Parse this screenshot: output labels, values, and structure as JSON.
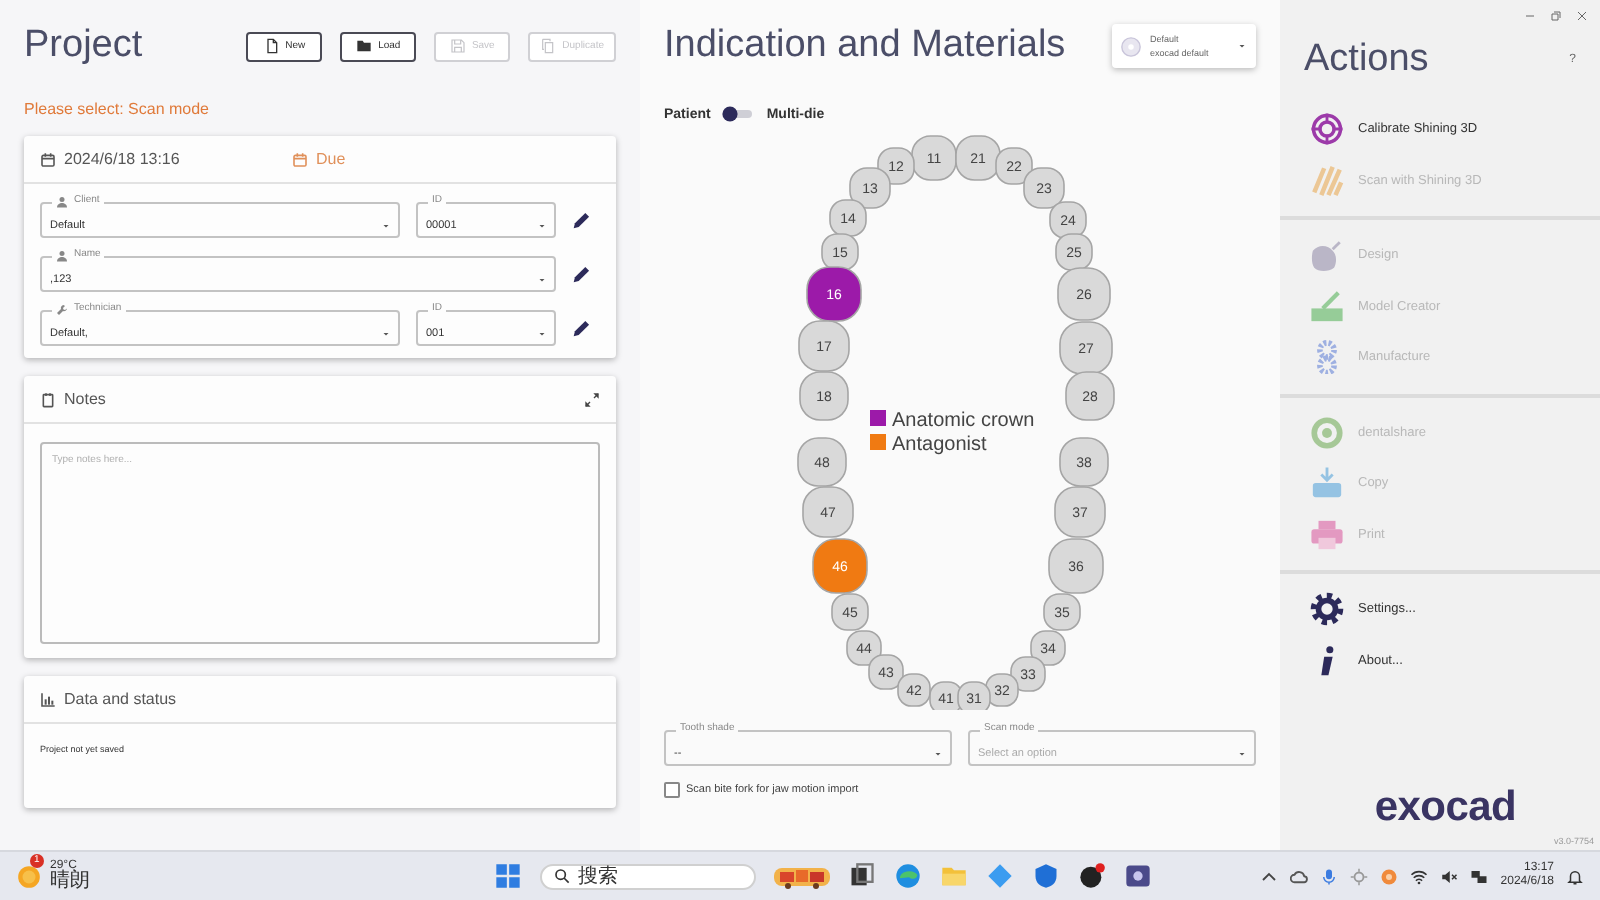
{
  "project": {
    "title": "Project",
    "buttons": [
      {
        "label": "New",
        "disabled": false
      },
      {
        "label": "Load",
        "disabled": false
      },
      {
        "label": "Save",
        "disabled": true
      },
      {
        "label": "Duplicate",
        "disabled": true
      }
    ],
    "warning": "Please select: Scan mode",
    "date": "2024/6/18 13:16",
    "due": "Due",
    "fields": [
      {
        "label": "Client",
        "value": "Default",
        "id_label": "ID",
        "id_value": "00001"
      },
      {
        "label": "Name",
        "value": ",123"
      },
      {
        "label": "Technician",
        "value": "Default,",
        "id_label": "ID",
        "id_value": "001"
      }
    ],
    "notes": {
      "title": "Notes",
      "placeholder": "Type notes here..."
    },
    "status": {
      "title": "Data and status",
      "text": "Project not yet saved"
    }
  },
  "indication": {
    "title": "Indication and Materials",
    "preset": {
      "name": "Default",
      "subtitle": "exocad default"
    },
    "toggle": {
      "left": "Patient",
      "right": "Multi-die",
      "on": false
    },
    "teeth": [
      {
        "number": "11",
        "color": "#d9d9d9"
      },
      {
        "number": "21",
        "color": "#d9d9d9"
      },
      {
        "number": "12",
        "color": "#d9d9d9"
      },
      {
        "number": "22",
        "color": "#d9d9d9"
      },
      {
        "number": "13",
        "color": "#d9d9d9"
      },
      {
        "number": "23",
        "color": "#d9d9d9"
      },
      {
        "number": "14",
        "color": "#d9d9d9"
      },
      {
        "number": "24",
        "color": "#d9d9d9"
      },
      {
        "number": "15",
        "color": "#d9d9d9"
      },
      {
        "number": "25",
        "color": "#d9d9d9"
      },
      {
        "number": "16",
        "color": "#9c1aa9"
      },
      {
        "number": "26",
        "color": "#d9d9d9"
      },
      {
        "number": "17",
        "color": "#d9d9d9"
      },
      {
        "number": "27",
        "color": "#d9d9d9"
      },
      {
        "number": "18",
        "color": "#d9d9d9"
      },
      {
        "number": "28",
        "color": "#d9d9d9"
      },
      {
        "number": "48",
        "color": "#d9d9d9"
      },
      {
        "number": "38",
        "color": "#d9d9d9"
      },
      {
        "number": "47",
        "color": "#d9d9d9"
      },
      {
        "number": "37",
        "color": "#d9d9d9"
      },
      {
        "number": "46",
        "color": "#f07a12"
      },
      {
        "number": "36",
        "color": "#d9d9d9"
      },
      {
        "number": "45",
        "color": "#d9d9d9"
      },
      {
        "number": "35",
        "color": "#d9d9d9"
      },
      {
        "number": "44",
        "color": "#d9d9d9"
      },
      {
        "number": "34",
        "color": "#d9d9d9"
      },
      {
        "number": "43",
        "color": "#d9d9d9"
      },
      {
        "number": "33",
        "color": "#d9d9d9"
      },
      {
        "number": "42",
        "color": "#d9d9d9"
      },
      {
        "number": "32",
        "color": "#d9d9d9"
      },
      {
        "number": "41",
        "color": "#d9d9d9"
      },
      {
        "number": "31",
        "color": "#d9d9d9"
      }
    ],
    "legend": [
      {
        "label": "Anatomic crown",
        "color": "#9c1aa9"
      },
      {
        "label": "Antagonist",
        "color": "#f07a12"
      }
    ],
    "tooth_shade": {
      "label": "Tooth shade",
      "value": "--"
    },
    "scan_mode": {
      "label": "Scan mode",
      "placeholder": "Select an option"
    },
    "bite_fork": {
      "label": "Scan bite fork for jaw motion import",
      "checked": false
    }
  },
  "actions": {
    "title": "Actions",
    "help": "?",
    "groups": [
      [
        {
          "label": "Calibrate Shining 3D",
          "disabled": false
        },
        {
          "label": "Scan with Shining 3D",
          "disabled": true
        }
      ],
      [
        {
          "label": "Design",
          "disabled": true
        },
        {
          "label": "Model Creator",
          "disabled": true
        },
        {
          "label": "Manufacture",
          "disabled": true
        }
      ],
      [
        {
          "label": "dentalshare",
          "disabled": true
        },
        {
          "label": "Copy",
          "disabled": true
        },
        {
          "label": "Print",
          "disabled": true
        }
      ],
      [
        {
          "label": "Settings...",
          "disabled": false
        },
        {
          "label": "About...",
          "disabled": false
        }
      ]
    ],
    "logo": "exocad",
    "version": "v3.0-7754"
  },
  "taskbar": {
    "temperature": "29°C",
    "weather": "晴朗",
    "badge": "1",
    "search": "搜索",
    "time": "13:17",
    "date": "2024/6/18"
  }
}
